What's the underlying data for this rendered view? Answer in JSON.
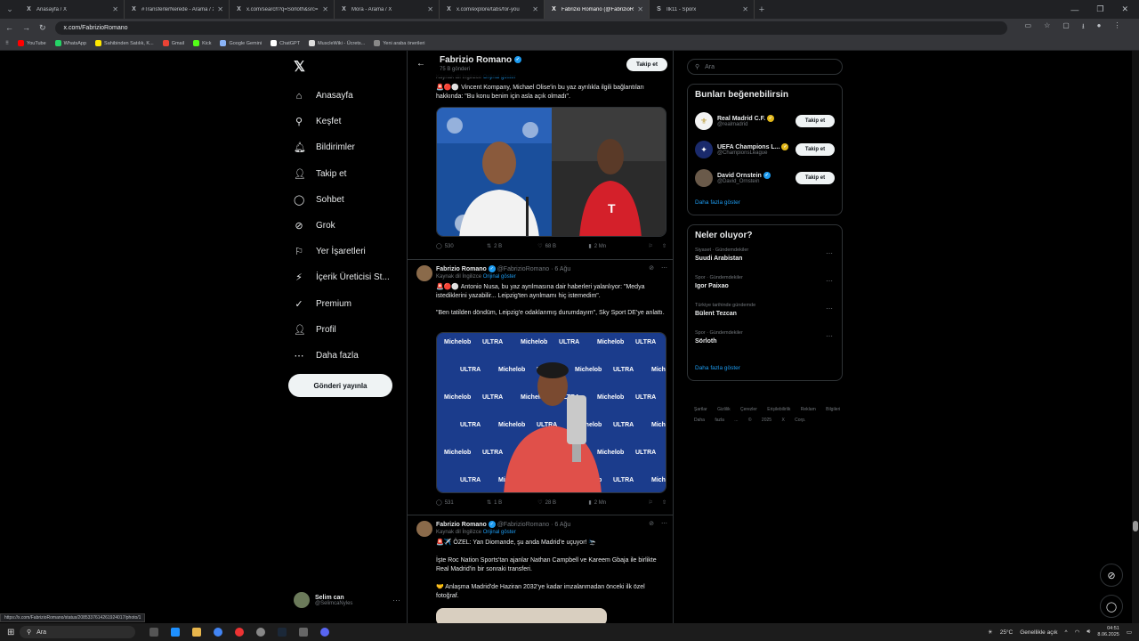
{
  "browser": {
    "tabs": [
      {
        "title": "Anasayfa / X",
        "icon": "X",
        "active": false
      },
      {
        "title": "#TransferlerNerede - Arama / X",
        "icon": "X",
        "active": false
      },
      {
        "title": "x.com/search?q=Sörloth&src=…",
        "icon": "X",
        "active": false
      },
      {
        "title": "Mora - Arama / X",
        "icon": "X",
        "active": false
      },
      {
        "title": "x.com/explore/tabs/for-you",
        "icon": "X",
        "active": false
      },
      {
        "title": "Fabrizio Romano (@FabrizioR…",
        "icon": "X",
        "active": true
      },
      {
        "title": "İlk11 - Sporx",
        "icon": "S",
        "active": false
      }
    ],
    "url": "x.com/FabrizioRomano",
    "bookmarks": [
      {
        "label": "YouTube",
        "color": "#ff0000"
      },
      {
        "label": "WhatsApp",
        "color": "#25d366"
      },
      {
        "label": "Sahibinden Satılık, K...",
        "color": "#ffe800"
      },
      {
        "label": "Gmail",
        "color": "#ea4335"
      },
      {
        "label": "Kick",
        "color": "#53fc18"
      },
      {
        "label": "Google Gemini",
        "color": "#8ab4f8"
      },
      {
        "label": "ChatGPT",
        "color": "#ffffff"
      },
      {
        "label": "MuscleWiki - Ücrets...",
        "color": "#dddddd"
      },
      {
        "label": "Yeni araba önerileri",
        "color": "#888888"
      }
    ],
    "status_url": "https://x.com/FabrizioRomano/status/2085337614261924017/photo/1"
  },
  "sidebar": {
    "items": [
      {
        "label": "Anasayfa",
        "icon": "home-icon",
        "glyph": "⌂"
      },
      {
        "label": "Keşfet",
        "icon": "search-icon",
        "glyph": "⚲"
      },
      {
        "label": "Bildirimler",
        "icon": "bell-icon",
        "glyph": "🔔︎"
      },
      {
        "label": "Takip et",
        "icon": "follow-icon",
        "glyph": "👤︎"
      },
      {
        "label": "Sohbet",
        "icon": "chat-icon",
        "glyph": "◯"
      },
      {
        "label": "Grok",
        "icon": "grok-icon",
        "glyph": "⊘"
      },
      {
        "label": "Yer İşaretleri",
        "icon": "bookmark-icon",
        "glyph": "⚐"
      },
      {
        "label": "İçerik Üreticisi St...",
        "icon": "creator-icon",
        "glyph": "⚡︎"
      },
      {
        "label": "Premium",
        "icon": "premium-icon",
        "glyph": "✓"
      },
      {
        "label": "Profil",
        "icon": "profile-icon",
        "glyph": "👤︎"
      },
      {
        "label": "Daha fazla",
        "icon": "more-icon",
        "glyph": "⋯"
      }
    ],
    "post_button": "Gönderi yayınla",
    "account": {
      "name": "Selim can",
      "handle": "@SelimcaNyles"
    }
  },
  "profile_header": {
    "name": "Fabrizio Romano",
    "post_count": "75 B gönderi",
    "follow": "Takip et"
  },
  "posts": [
    {
      "source": "Kaynak dil İngilizce",
      "show_original": "Orijinal göster",
      "text": "🚨🔴⚪ Vincent Kompany, Michael Olise'in bu yaz ayrılıkla ilgili bağlantıları hakkında: \"Bu konu benim için asla açık olmadı\".",
      "stats": {
        "replies": "530",
        "reposts": "2 B",
        "likes": "68 B",
        "views": "2 Mn"
      }
    },
    {
      "author": "Fabrizio Romano",
      "handle": "@FabrizioRomano",
      "time": "6 Ağu",
      "source": "Kaynak dil İngilizce",
      "show_original": "Orijinal göster",
      "text1": "🚨🔴⚪ Antonio Nusa, bu yaz ayrılmasına dair haberleri yalanlıyor: \"Medya istediklerini yazabilir... Leipzig'ten ayrılmamı hiç istemedim\".",
      "text2": "\"Ben tatilden döndüm, Leipzig'e odaklanmış durumdayım\", Sky Sport DE'ye anlattı.",
      "stats": {
        "replies": "531",
        "reposts": "1 B",
        "likes": "28 B",
        "views": "2 Mn"
      }
    },
    {
      "author": "Fabrizio Romano",
      "handle": "@FabrizioRomano",
      "time": "6 Ağu",
      "source": "Kaynak dil İngilizce",
      "show_original": "Orijinal göster",
      "text1": "🚨✈️ ÖZEL: Yan Diomande, şu anda Madrid'e uçuyor! 🛬",
      "text2": "İşte Roc Nation Sports'tan ajanlar Nathan Campbell ve Kareem Gbaja ile birlikte Real Madrid'in bir sonraki transferi.",
      "text3": "🤝 Anlaşma Madrid'de Haziran 2032'ye kadar imzalanmadan önceki ilk özel fotoğraf."
    }
  ],
  "media_text": {
    "ad_word": "ULTRA",
    "ad_brand": "Michelob"
  },
  "right": {
    "search_placeholder": "Ara",
    "who_to_follow": {
      "title": "Bunları beğenebilirsin",
      "items": [
        {
          "name": "Real Madrid C.F.",
          "handle": "@realmadrid",
          "badge": "gold",
          "button": "Takip et"
        },
        {
          "name": "UEFA Champions L...",
          "handle": "@ChampionsLeague",
          "badge": "gold",
          "button": "Takip et"
        },
        {
          "name": "David Ornstein",
          "handle": "@David_Ornstein",
          "badge": "blue",
          "button": "Takip et"
        }
      ],
      "more": "Daha fazla göster"
    },
    "trends": {
      "title": "Neler oluyor?",
      "items": [
        {
          "category": "Siyaset · Gündemdekiler",
          "name": "Suudi Arabistan"
        },
        {
          "category": "Spor · Gündemdekiler",
          "name": "Igor Paixao"
        },
        {
          "category": "Türkiye tarihinde gündemde",
          "name": "Bülent Tezcan"
        },
        {
          "category": "Spor · Gündemdekiler",
          "name": "Sörloth"
        }
      ],
      "more": "Daha fazla göster"
    },
    "footer": [
      "Şartlar",
      "Gizlilik",
      "Çerezler",
      "Erişilebilirlik",
      "Reklam Bilgileri",
      "Daha fazla ...",
      "© 2025 X Corp."
    ]
  },
  "taskbar": {
    "search": "Ara",
    "weather": "25°C",
    "weather_desc": "Genellikle açık",
    "time": "04:51",
    "date": "8.06.2025"
  }
}
